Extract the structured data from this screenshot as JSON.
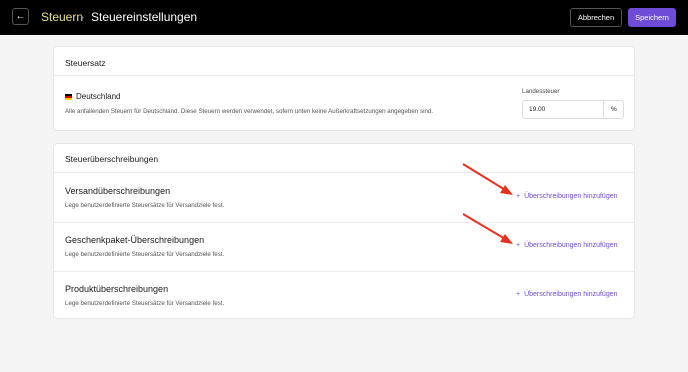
{
  "header": {
    "back_icon": "arrow-left-icon",
    "breadcrumb_parent": "Steuern",
    "breadcrumb_separator": "›",
    "breadcrumb_current": "Steuereinstellungen",
    "cancel_label": "Abbrechen",
    "save_label": "Speichern",
    "colors": {
      "bar": "#000000",
      "parent_link": "#e7e48b",
      "primary": "#6d4cd8"
    }
  },
  "tax_rate": {
    "title": "Steuersatz",
    "country": "Deutschland",
    "description": "Alle anfallenden Steuern für Deutschland. Diese Steuern werden verwendet, sofern unten keine Außerkraftsetzungen angegeben sind.",
    "field_label": "Landessteuer",
    "field_value": "19.00",
    "field_unit": "%"
  },
  "overrides": {
    "title": "Steuerüberschreibungen",
    "add_label": "Überschreibungen hinzufügen",
    "add_icon": "plus",
    "sections": [
      {
        "title": "Versandüberschreibungen",
        "description": "Lege benutzerdefinierte Steuersätze für Versandziele fest."
      },
      {
        "title": "Geschenkpaket-Überschreibungen",
        "description": "Lege benutzerdefinierte Steuersätze für Versandziele fest."
      },
      {
        "title": "Produktüberschreibungen",
        "description": "Lege benutzerdefinierte Steuersätze für Versandziele fest."
      }
    ]
  },
  "annotation_color": "#e8321f"
}
